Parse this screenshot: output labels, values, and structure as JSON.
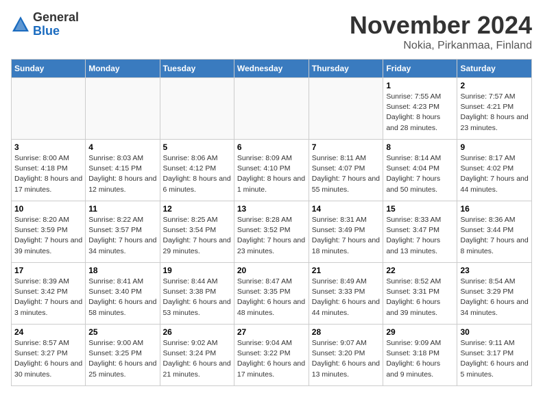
{
  "header": {
    "logo_general": "General",
    "logo_blue": "Blue",
    "month_title": "November 2024",
    "location": "Nokia, Pirkanmaa, Finland"
  },
  "days_of_week": [
    "Sunday",
    "Monday",
    "Tuesday",
    "Wednesday",
    "Thursday",
    "Friday",
    "Saturday"
  ],
  "weeks": [
    [
      {
        "day": "",
        "info": ""
      },
      {
        "day": "",
        "info": ""
      },
      {
        "day": "",
        "info": ""
      },
      {
        "day": "",
        "info": ""
      },
      {
        "day": "",
        "info": ""
      },
      {
        "day": "1",
        "info": "Sunrise: 7:55 AM\nSunset: 4:23 PM\nDaylight: 8 hours and 28 minutes."
      },
      {
        "day": "2",
        "info": "Sunrise: 7:57 AM\nSunset: 4:21 PM\nDaylight: 8 hours and 23 minutes."
      }
    ],
    [
      {
        "day": "3",
        "info": "Sunrise: 8:00 AM\nSunset: 4:18 PM\nDaylight: 8 hours and 17 minutes."
      },
      {
        "day": "4",
        "info": "Sunrise: 8:03 AM\nSunset: 4:15 PM\nDaylight: 8 hours and 12 minutes."
      },
      {
        "day": "5",
        "info": "Sunrise: 8:06 AM\nSunset: 4:12 PM\nDaylight: 8 hours and 6 minutes."
      },
      {
        "day": "6",
        "info": "Sunrise: 8:09 AM\nSunset: 4:10 PM\nDaylight: 8 hours and 1 minute."
      },
      {
        "day": "7",
        "info": "Sunrise: 8:11 AM\nSunset: 4:07 PM\nDaylight: 7 hours and 55 minutes."
      },
      {
        "day": "8",
        "info": "Sunrise: 8:14 AM\nSunset: 4:04 PM\nDaylight: 7 hours and 50 minutes."
      },
      {
        "day": "9",
        "info": "Sunrise: 8:17 AM\nSunset: 4:02 PM\nDaylight: 7 hours and 44 minutes."
      }
    ],
    [
      {
        "day": "10",
        "info": "Sunrise: 8:20 AM\nSunset: 3:59 PM\nDaylight: 7 hours and 39 minutes."
      },
      {
        "day": "11",
        "info": "Sunrise: 8:22 AM\nSunset: 3:57 PM\nDaylight: 7 hours and 34 minutes."
      },
      {
        "day": "12",
        "info": "Sunrise: 8:25 AM\nSunset: 3:54 PM\nDaylight: 7 hours and 29 minutes."
      },
      {
        "day": "13",
        "info": "Sunrise: 8:28 AM\nSunset: 3:52 PM\nDaylight: 7 hours and 23 minutes."
      },
      {
        "day": "14",
        "info": "Sunrise: 8:31 AM\nSunset: 3:49 PM\nDaylight: 7 hours and 18 minutes."
      },
      {
        "day": "15",
        "info": "Sunrise: 8:33 AM\nSunset: 3:47 PM\nDaylight: 7 hours and 13 minutes."
      },
      {
        "day": "16",
        "info": "Sunrise: 8:36 AM\nSunset: 3:44 PM\nDaylight: 7 hours and 8 minutes."
      }
    ],
    [
      {
        "day": "17",
        "info": "Sunrise: 8:39 AM\nSunset: 3:42 PM\nDaylight: 7 hours and 3 minutes."
      },
      {
        "day": "18",
        "info": "Sunrise: 8:41 AM\nSunset: 3:40 PM\nDaylight: 6 hours and 58 minutes."
      },
      {
        "day": "19",
        "info": "Sunrise: 8:44 AM\nSunset: 3:38 PM\nDaylight: 6 hours and 53 minutes."
      },
      {
        "day": "20",
        "info": "Sunrise: 8:47 AM\nSunset: 3:35 PM\nDaylight: 6 hours and 48 minutes."
      },
      {
        "day": "21",
        "info": "Sunrise: 8:49 AM\nSunset: 3:33 PM\nDaylight: 6 hours and 44 minutes."
      },
      {
        "day": "22",
        "info": "Sunrise: 8:52 AM\nSunset: 3:31 PM\nDaylight: 6 hours and 39 minutes."
      },
      {
        "day": "23",
        "info": "Sunrise: 8:54 AM\nSunset: 3:29 PM\nDaylight: 6 hours and 34 minutes."
      }
    ],
    [
      {
        "day": "24",
        "info": "Sunrise: 8:57 AM\nSunset: 3:27 PM\nDaylight: 6 hours and 30 minutes."
      },
      {
        "day": "25",
        "info": "Sunrise: 9:00 AM\nSunset: 3:25 PM\nDaylight: 6 hours and 25 minutes."
      },
      {
        "day": "26",
        "info": "Sunrise: 9:02 AM\nSunset: 3:24 PM\nDaylight: 6 hours and 21 minutes."
      },
      {
        "day": "27",
        "info": "Sunrise: 9:04 AM\nSunset: 3:22 PM\nDaylight: 6 hours and 17 minutes."
      },
      {
        "day": "28",
        "info": "Sunrise: 9:07 AM\nSunset: 3:20 PM\nDaylight: 6 hours and 13 minutes."
      },
      {
        "day": "29",
        "info": "Sunrise: 9:09 AM\nSunset: 3:18 PM\nDaylight: 6 hours and 9 minutes."
      },
      {
        "day": "30",
        "info": "Sunrise: 9:11 AM\nSunset: 3:17 PM\nDaylight: 6 hours and 5 minutes."
      }
    ]
  ]
}
